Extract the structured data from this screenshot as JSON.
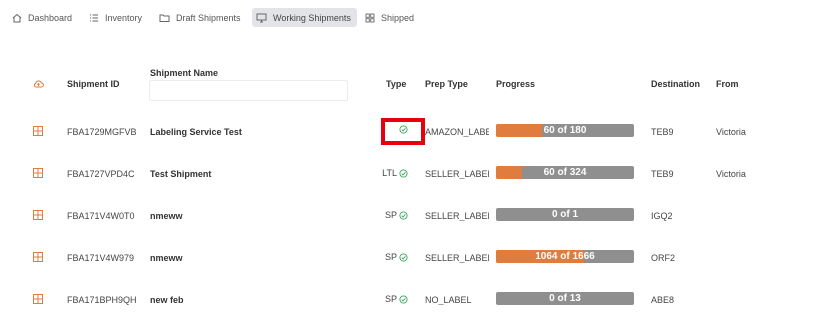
{
  "nav": {
    "items": [
      {
        "label": "Dashboard",
        "icon": "home-icon"
      },
      {
        "label": "Inventory",
        "icon": "list-icon"
      },
      {
        "label": "Draft Shipments",
        "icon": "folder-icon"
      },
      {
        "label": "Working Shipments",
        "icon": "monitor-icon",
        "active": true
      },
      {
        "label": "Shipped",
        "icon": "grid-icon"
      }
    ]
  },
  "table": {
    "header_icon": "sync-cloud-icon",
    "columns": {
      "shipment_id": "Shipment ID",
      "shipment_name": "Shipment Name",
      "type": "Type",
      "prep_type": "Prep Type",
      "progress": "Progress",
      "destination": "Destination",
      "from": "From"
    },
    "name_filter": {
      "value": "",
      "placeholder": ""
    },
    "rows": [
      {
        "id": "FBA1729MGFVB",
        "name": "Labeling Service Test",
        "type": "",
        "prep": "AMAZON_LABEL",
        "progress_text": "60 of 180",
        "progress_fraction": 0.333,
        "destination": "TEB9",
        "from": "Victoria"
      },
      {
        "id": "FBA1727VPD4C",
        "name": "Test Shipment",
        "type": "LTL",
        "prep": "SELLER_LABEL",
        "progress_text": "60 of 324",
        "progress_fraction": 0.185,
        "destination": "TEB9",
        "from": "Victoria"
      },
      {
        "id": "FBA171V4W0T0",
        "name": "nmeww",
        "type": "SP",
        "prep": "SELLER_LABEL",
        "progress_text": "0 of 1",
        "progress_fraction": 0,
        "destination": "IGQ2",
        "from": ""
      },
      {
        "id": "FBA171V4W979",
        "name": "nmeww",
        "type": "SP",
        "prep": "SELLER_LABEL",
        "progress_text": "1064 of 1666",
        "progress_fraction": 0.639,
        "destination": "ORF2",
        "from": ""
      },
      {
        "id": "FBA171BPH9QH",
        "name": "new feb",
        "type": "SP",
        "prep": "NO_LABEL",
        "progress_text": "0 of 13",
        "progress_fraction": 0,
        "destination": "ABE8",
        "from": ""
      }
    ]
  },
  "colors": {
    "accent": "#e07c3e",
    "bar_bg": "#8f8f8f",
    "check": "#3aa35b",
    "highlight": "#e8000d"
  }
}
